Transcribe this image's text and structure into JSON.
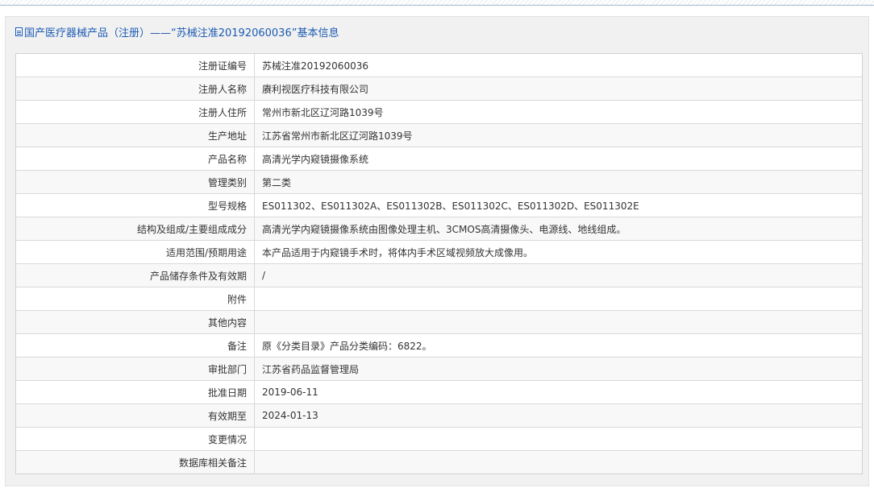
{
  "header": {
    "title": "国产医疗器械产品（注册）——“苏械注准20192060036”基本信息"
  },
  "rows": [
    {
      "label": "注册证编号",
      "value": "苏械注准20192060036"
    },
    {
      "label": "注册人名称",
      "value": "赓利视医疗科技有限公司"
    },
    {
      "label": "注册人住所",
      "value": "常州市新北区辽河路1039号"
    },
    {
      "label": "生产地址",
      "value": "江苏省常州市新北区辽河路1039号"
    },
    {
      "label": "产品名称",
      "value": "高清光学内窥镜摄像系统"
    },
    {
      "label": "管理类别",
      "value": "第二类"
    },
    {
      "label": "型号规格",
      "value": "ES011302、ES011302A、ES011302B、ES011302C、ES011302D、ES011302E"
    },
    {
      "label": "结构及组成/主要组成成分",
      "value": "高清光学内窥镜摄像系统由图像处理主机、3CMOS高清摄像头、电源线、地线组成。"
    },
    {
      "label": "适用范围/预期用途",
      "value": "本产品适用于内窥镜手术时，将体内手术区域视频放大成像用。"
    },
    {
      "label": "产品储存条件及有效期",
      "value": "/"
    },
    {
      "label": "附件",
      "value": ""
    },
    {
      "label": "其他内容",
      "value": ""
    },
    {
      "label": "备注",
      "value": "原《分类目录》产品分类编码：6822。"
    },
    {
      "label": "审批部门",
      "value": "江苏省药品监督管理局"
    },
    {
      "label": "批准日期",
      "value": "2019-06-11"
    },
    {
      "label": "有效期至",
      "value": "2024-01-13"
    },
    {
      "label": "变更情况",
      "value": ""
    },
    {
      "label": "数据库相关备注",
      "value": ""
    }
  ]
}
